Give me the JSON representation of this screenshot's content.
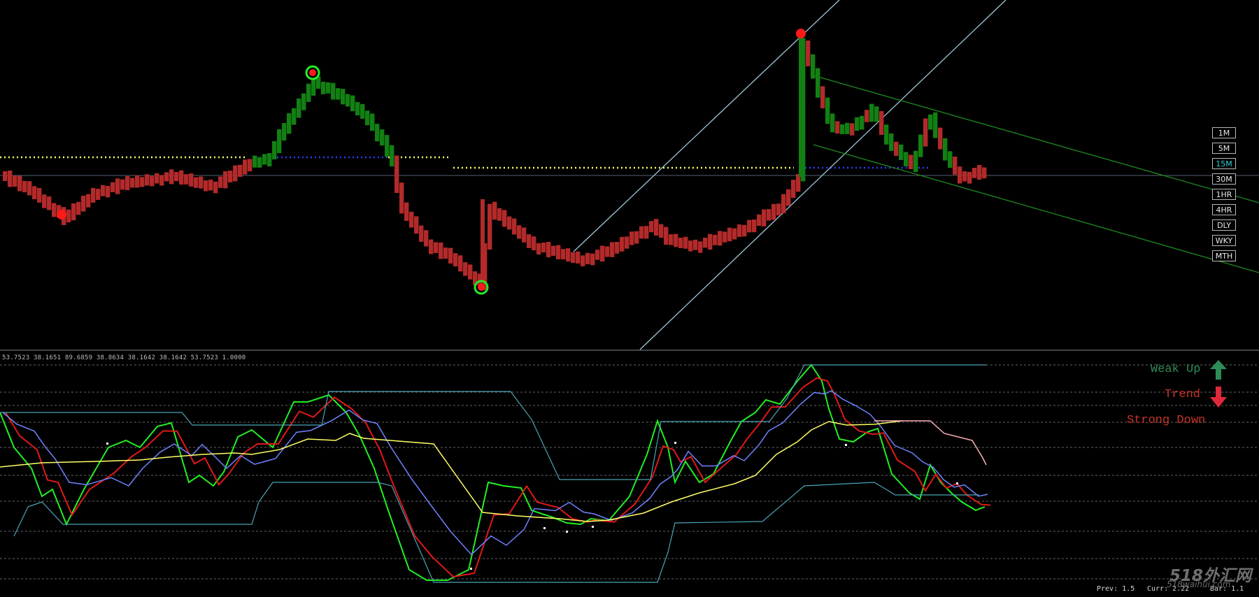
{
  "timeframes": [
    {
      "label": "1M",
      "active": false
    },
    {
      "label": "5M",
      "active": false
    },
    {
      "label": "15M",
      "active": true
    },
    {
      "label": "30M",
      "active": false
    },
    {
      "label": "1HR",
      "active": false
    },
    {
      "label": "4HR",
      "active": false
    },
    {
      "label": "DLY",
      "active": false
    },
    {
      "label": "WKY",
      "active": false
    },
    {
      "label": "MTH",
      "active": false
    }
  ],
  "indicator": {
    "readout": "53.7523 38.1651 89.6859 38.8634 38.1642 38.1642 53.7523 1.0000"
  },
  "signals": {
    "line1": "Weak Up",
    "line2": "Trend",
    "line3": "Strong Down",
    "up_arrow_icon": "arrow-up-icon",
    "down_arrow_icon": "arrow-down-icon",
    "color_up": "#2e8b57",
    "color_down": "#c83228"
  },
  "footer": {
    "prev": "Prev: 1.5",
    "curr": "Curr: 2.22",
    "bar": "Bar: 1.1"
  },
  "watermark": {
    "main": "518外汇网",
    "sub": "518waihui.com"
  },
  "colors": {
    "bull": "#128012",
    "bear": "#b22a2a",
    "green_line": "#22ee22",
    "red_line": "#e01818",
    "blue_line": "#6f83ff",
    "yellow_line": "#ffff66",
    "band_line": "#4aa5b5"
  }
}
